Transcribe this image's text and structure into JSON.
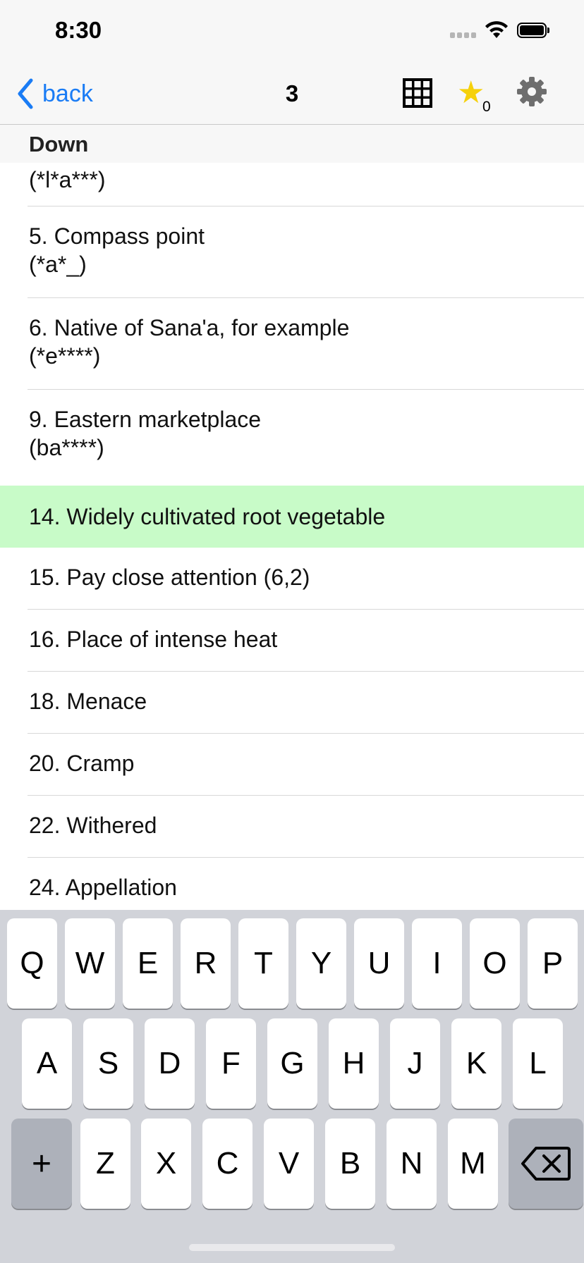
{
  "status_bar": {
    "time": "8:30"
  },
  "nav": {
    "back_label": "back",
    "title": "3",
    "star_count": "0"
  },
  "section": {
    "title": "Down"
  },
  "clues": [
    {
      "clue": "",
      "pattern": "(*l*a***)"
    },
    {
      "clue": "5. Compass point",
      "pattern": "(*a*_)"
    },
    {
      "clue": "6. Native of Sana'a, for example",
      "pattern": "(*e****)"
    },
    {
      "clue": "9. Eastern marketplace",
      "pattern": "(ba****)"
    },
    {
      "clue": "14. Widely cultivated root vegetable",
      "pattern": ""
    },
    {
      "clue": "15. Pay close attention (6,2)",
      "pattern": ""
    },
    {
      "clue": "16. Place of intense heat",
      "pattern": ""
    },
    {
      "clue": "18. Menace",
      "pattern": ""
    },
    {
      "clue": "20. Cramp",
      "pattern": ""
    },
    {
      "clue": "22. Withered",
      "pattern": ""
    },
    {
      "clue": "24. Appellation",
      "pattern": ""
    }
  ],
  "keyboard": {
    "row1": [
      "Q",
      "W",
      "E",
      "R",
      "T",
      "Y",
      "U",
      "I",
      "O",
      "P"
    ],
    "row2": [
      "A",
      "S",
      "D",
      "F",
      "G",
      "H",
      "J",
      "K",
      "L"
    ],
    "row3": [
      "Z",
      "X",
      "C",
      "V",
      "B",
      "N",
      "M"
    ],
    "plus_label": "+"
  },
  "colors": {
    "accent": "#1a7cf5",
    "selected_row": "#c8fbc8",
    "star": "#f6d10b"
  }
}
